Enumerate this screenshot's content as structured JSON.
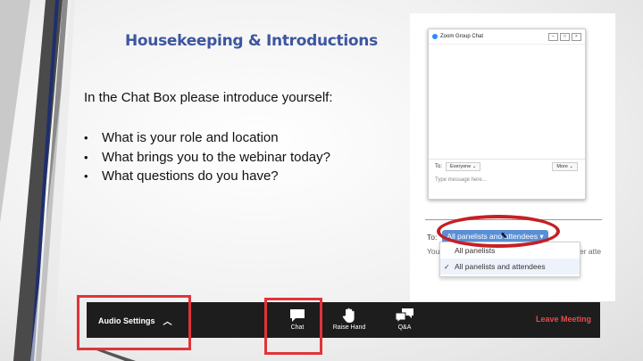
{
  "slide": {
    "title": "Housekeeping & Introductions",
    "intro": "In the Chat Box please introduce yourself:",
    "bullets": [
      "What is your role and location",
      "What brings you to the webinar today?",
      "What questions do you have?"
    ]
  },
  "chat_window": {
    "title": "Zoom Group Chat",
    "to_label": "To:",
    "to_value": "Everyone",
    "more_label": "More",
    "placeholder": "Type message here...",
    "window_buttons": [
      "–",
      "□",
      "×"
    ]
  },
  "dropdown": {
    "to_label": "To:",
    "selected": "All panelists and attendees",
    "partial_left": "You",
    "partial_right": "er atte",
    "options": [
      "All panelists",
      "All panelists and attendees"
    ],
    "checked_index": 1
  },
  "toolbar": {
    "audio_settings": "Audio Settings",
    "chat": "Chat",
    "raise_hand": "Raise Hand",
    "qa": "Q&A",
    "leave": "Leave Meeting"
  },
  "colors": {
    "title": "#3c56a0",
    "highlight": "#e0343a",
    "leave": "#e84a4a",
    "deco_navy": "#1f2f6e",
    "deco_gray": "#4a4a4a"
  }
}
